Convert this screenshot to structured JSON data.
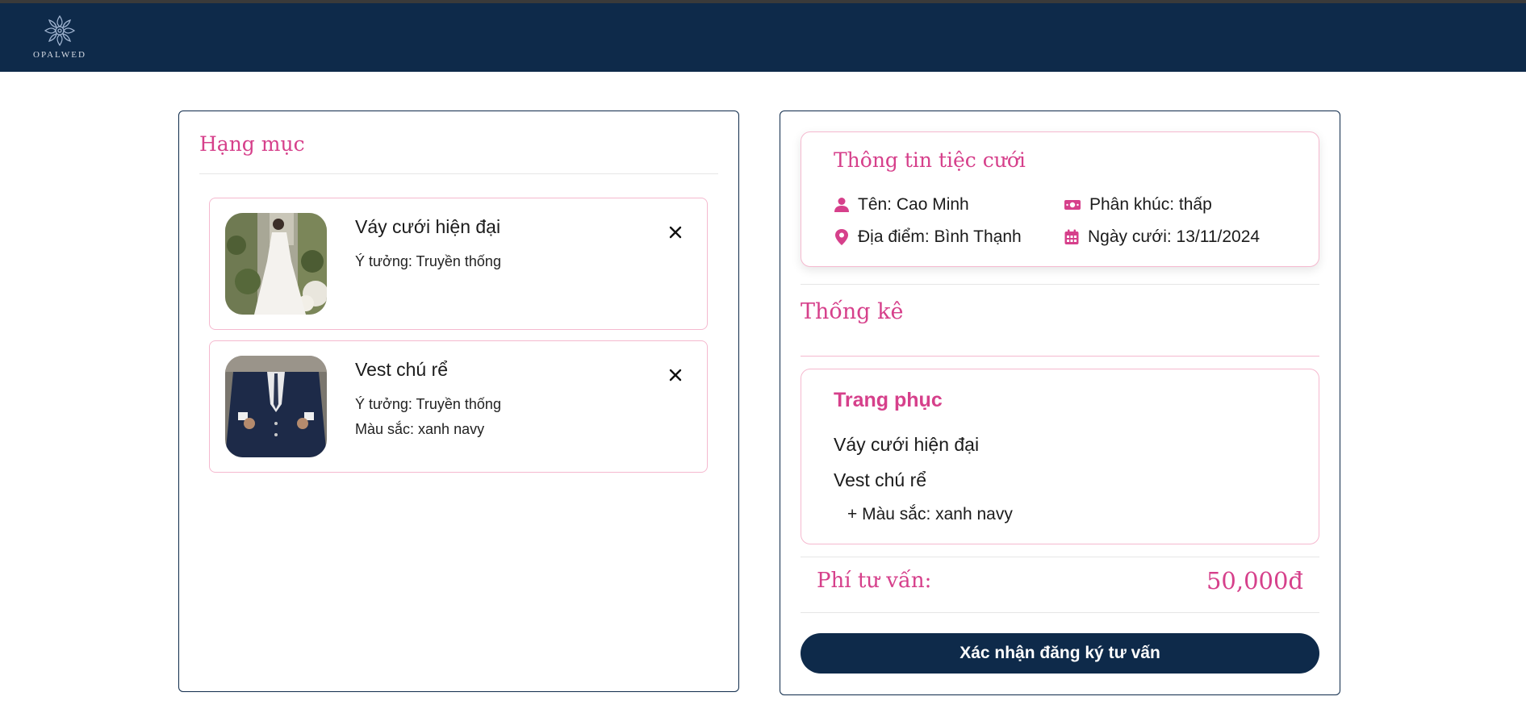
{
  "brand": {
    "logo_text": "OPALWED"
  },
  "categories": {
    "title": "Hạng mục",
    "items": [
      {
        "name": "Váy cưới hiện đại",
        "idea": "Ý tưởng: Truyền thống",
        "color": ""
      },
      {
        "name": "Vest chú rể",
        "idea": "Ý tưởng: Truyền thống",
        "color": "Màu sắc: xanh navy"
      }
    ]
  },
  "wedding_info": {
    "title": "Thông tin tiệc cưới",
    "name": "Tên: Cao Minh",
    "segment": "Phân khúc: thấp",
    "location": "Địa điểm: Bình Thạnh",
    "date": "Ngày cưới: 13/11/2024"
  },
  "stats": {
    "title": "Thống kê",
    "outfit": {
      "title": "Trang phục",
      "lines": [
        "Váy cưới hiện đại",
        "Vest chú rể",
        "+ Màu sắc: xanh navy"
      ]
    },
    "fee_label": "Phí tư vấn:",
    "fee_value": "50,000đ"
  },
  "confirm_button": "Xác nhận đăng ký tư vấn",
  "colors": {
    "navy": "#0e2a4a",
    "pink": "#d6408b",
    "pink_border": "#f5b9cf"
  }
}
